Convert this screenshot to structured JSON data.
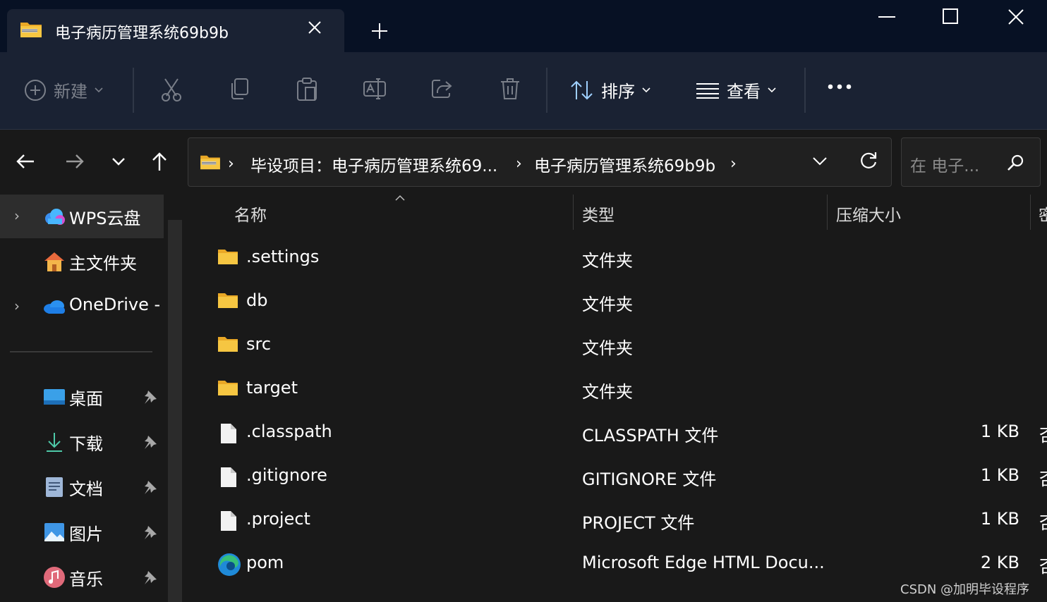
{
  "window": {
    "tab_title": "电子病历管理系统69b9b",
    "tab_close_icon": "close-icon",
    "new_tab_icon": "plus-icon"
  },
  "toolbar": {
    "new_label": "新建",
    "sort_label": "排序",
    "view_label": "查看",
    "icons": [
      "new-icon",
      "cut-icon",
      "copy-icon",
      "paste-icon",
      "rename-icon",
      "share-icon",
      "delete-icon",
      "more-icon"
    ]
  },
  "address": {
    "crumbs": [
      "毕设项目：电子病历管理系统69...",
      "电子病历管理系统69b9b"
    ],
    "search_placeholder": "在 电子..."
  },
  "sidebar": {
    "items": [
      {
        "label": "WPS云盘",
        "icon": "cloud-icon"
      },
      {
        "label": "主文件夹",
        "icon": "home-icon"
      },
      {
        "label": "OneDrive -",
        "icon": "onedrive-icon"
      },
      {
        "label": "桌面",
        "icon": "desktop-icon"
      },
      {
        "label": "下载",
        "icon": "download-icon"
      },
      {
        "label": "文档",
        "icon": "document-icon"
      },
      {
        "label": "图片",
        "icon": "picture-icon"
      },
      {
        "label": "音乐",
        "icon": "music-icon"
      }
    ]
  },
  "columns": {
    "name": "名称",
    "type": "类型",
    "compressed_size": "压缩大小",
    "extra": "密"
  },
  "files": [
    {
      "name": ".settings",
      "type": "文件夹",
      "size": "",
      "extra": "",
      "icon": "folder-icon"
    },
    {
      "name": "db",
      "type": "文件夹",
      "size": "",
      "extra": "",
      "icon": "folder-icon"
    },
    {
      "name": "src",
      "type": "文件夹",
      "size": "",
      "extra": "",
      "icon": "folder-icon"
    },
    {
      "name": "target",
      "type": "文件夹",
      "size": "",
      "extra": "",
      "icon": "folder-icon"
    },
    {
      "name": ".classpath",
      "type": "CLASSPATH 文件",
      "size": "1 KB",
      "extra": "否",
      "icon": "file-icon"
    },
    {
      "name": ".gitignore",
      "type": "GITIGNORE 文件",
      "size": "1 KB",
      "extra": "否",
      "icon": "file-icon"
    },
    {
      "name": ".project",
      "type": "PROJECT 文件",
      "size": "1 KB",
      "extra": "否",
      "icon": "file-icon"
    },
    {
      "name": "pom",
      "type": "Microsoft Edge HTML Docu...",
      "size": "2 KB",
      "extra": "否",
      "icon": "edge-icon"
    }
  ],
  "watermark": "CSDN @加明毕设程序",
  "colors": {
    "titlebar": "#071124",
    "toolbar": "#1a2233",
    "background": "#191919",
    "folder": "#f6c642"
  }
}
